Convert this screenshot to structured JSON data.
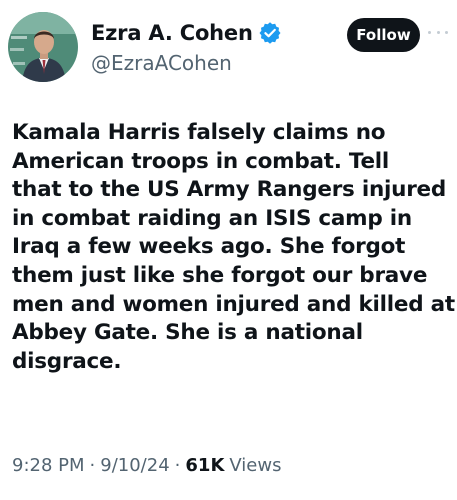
{
  "author": {
    "display_name": "Ezra A. Cohen",
    "handle": "@EzraACohen",
    "verified_icon": "verified-badge-icon"
  },
  "follow_label": "Follow",
  "more_icon": "more-options-icon",
  "tweet": {
    "lines": [
      "Kamala Harris falsely claims no",
      "American troops in combat. Tell",
      "that to the US Army Rangers injured",
      "in combat raiding an ISIS camp in",
      "Iraq a few weeks ago. She forgot",
      "them just like she forgot our brave",
      "men and women injured and killed at",
      "Abbey Gate. She is a national",
      "disgrace."
    ]
  },
  "meta": {
    "time": "9:28 PM",
    "separator": "·",
    "date": "9/10/24",
    "views_count": "61K",
    "views_label": "Views"
  },
  "colors": {
    "text_primary": "#0f1419",
    "text_secondary": "#536471",
    "verified_blue": "#1d9bf0",
    "follow_bg": "#0f1419"
  }
}
